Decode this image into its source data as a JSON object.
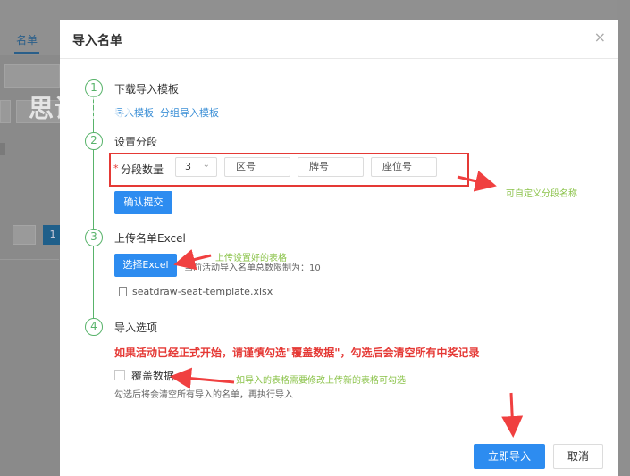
{
  "background": {
    "tab_label": "名单",
    "page_number": "1"
  },
  "watermark": "思讯互动",
  "modal": {
    "title": "导入名单",
    "close_icon": "×"
  },
  "steps": [
    {
      "number": "1",
      "title": "下载导入模板",
      "links": [
        "导入模板",
        "分组导入模板"
      ]
    },
    {
      "number": "2",
      "title": "设置分段"
    },
    {
      "number": "3",
      "title": "上传名单Excel"
    },
    {
      "number": "4",
      "title": "导入选项"
    }
  ],
  "segment": {
    "required_mark": "*",
    "label": "分段数量",
    "count_value": "3",
    "placeholders": [
      "区号",
      "牌号",
      "座位号"
    ],
    "confirm_label": "确认提交"
  },
  "upload": {
    "button_label": "选择Excel",
    "limit_hint": "当前活动导入名单总数限制为：10",
    "file_name": "seatdraw-seat-template.xlsx"
  },
  "options": {
    "warning": "如果活动已经正式开始，请谨慎勾选\"覆盖数据\"，勾选后会清空所有中奖记录",
    "checkbox_label": "覆盖数据",
    "checkbox_checked": false,
    "checkbox_hint": "勾选后将会清空所有导入的名单，再执行导入"
  },
  "footer": {
    "import_label": "立即导入",
    "cancel_label": "取消"
  },
  "annotations": {
    "segment_note": "可自定义分段名称",
    "upload_note": "上传设置好的表格",
    "overwrite_note": "如导入的表格需要修改上传新的表格可勾选"
  },
  "colors": {
    "primary": "#2d8cf0",
    "step_green": "#58b36a",
    "warning_red": "#e53935",
    "annotation_green": "#8bc34a"
  }
}
